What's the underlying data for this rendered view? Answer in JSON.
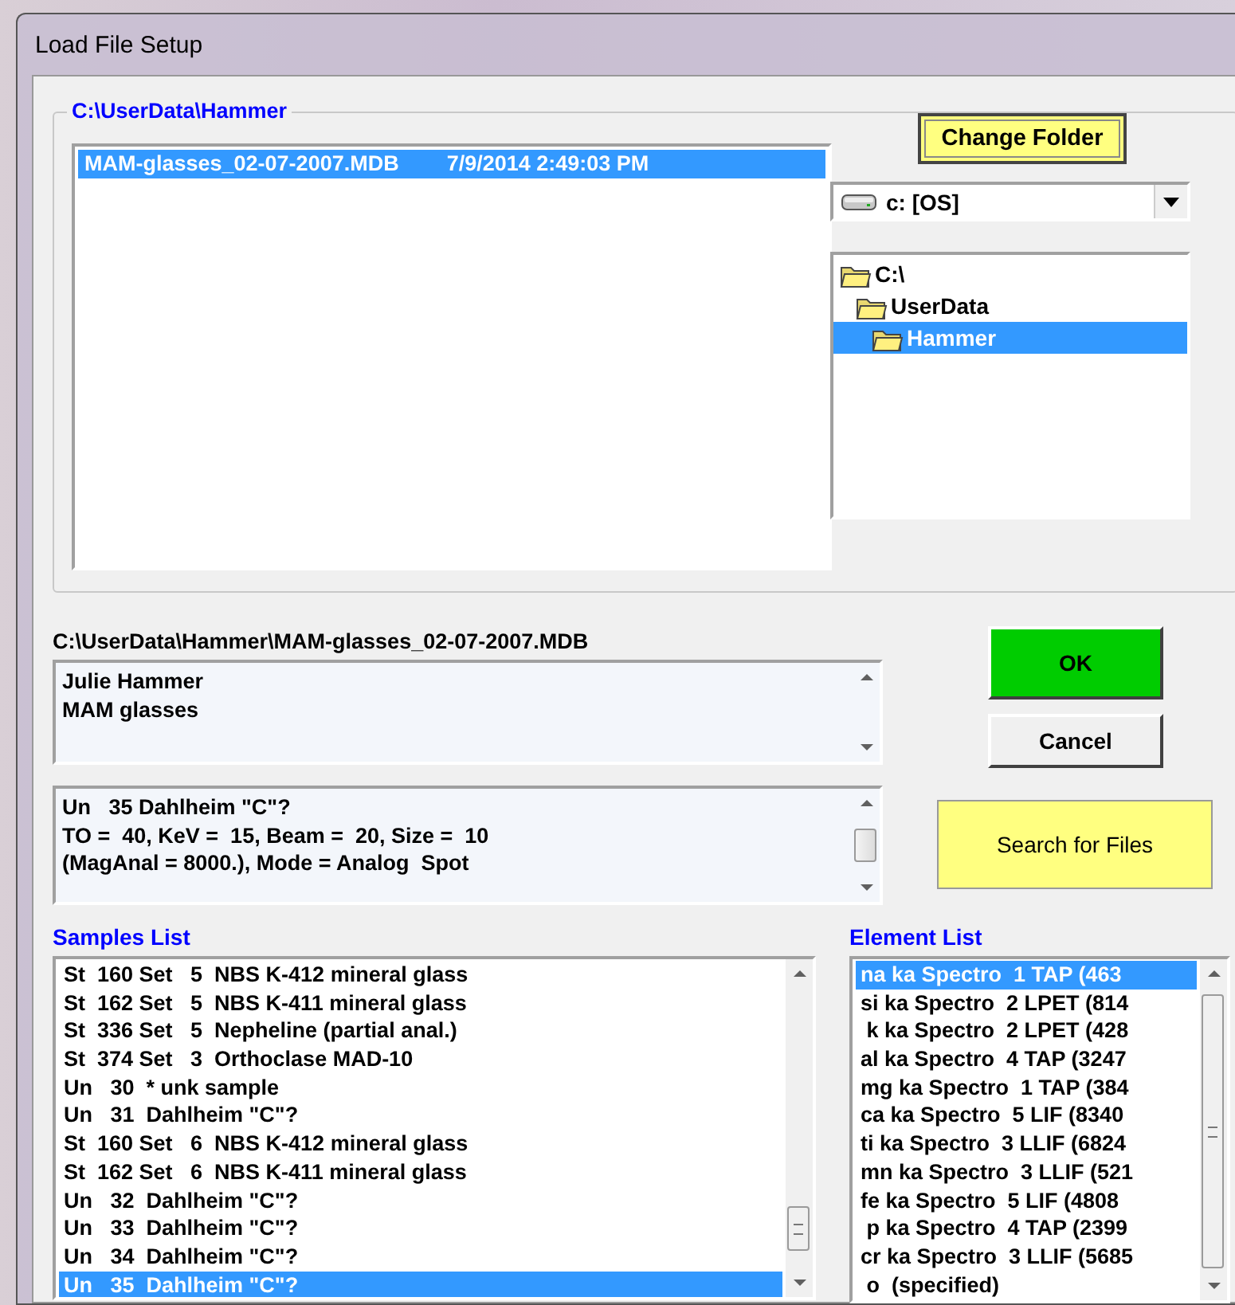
{
  "window": {
    "title": "Load File Setup"
  },
  "folder_group": {
    "title": "C:\\UserData\\Hammer",
    "files": [
      {
        "name": "MAM-glasses_02-07-2007.MDB",
        "date": "7/9/2014 2:49:03 PM",
        "selected": true
      }
    ]
  },
  "change_folder_button": {
    "label": "Change Folder"
  },
  "drive": {
    "value": "c: [OS]"
  },
  "folder_tree": [
    {
      "label": "C:\\",
      "selected": false,
      "children": [
        {
          "label": "UserData",
          "selected": false,
          "children": [
            {
              "label": "Hammer",
              "selected": true
            }
          ]
        }
      ]
    }
  ],
  "file_path": "C:\\UserData\\Hammer\\MAM-glasses_02-07-2007.MDB",
  "description": [
    "Julie Hammer",
    "MAM glasses"
  ],
  "sample_info": [
    "Un   35 Dahlheim \"C\"?",
    "TO =  40, KeV =  15, Beam =  20, Size =  10",
    "(MagAnal = 8000.), Mode = Analog  Spot"
  ],
  "buttons": [
    {
      "kind": "ok",
      "label": "OK"
    },
    {
      "kind": "cancel",
      "label": "Cancel"
    },
    {
      "kind": "search",
      "label": "Search for Files"
    }
  ],
  "samples_list": {
    "title": "Samples List",
    "items": [
      {
        "text": "St  160 Set   5  NBS K-412 mineral glass",
        "selected": false
      },
      {
        "text": "St  162 Set   5  NBS K-411 mineral glass",
        "selected": false
      },
      {
        "text": "St  336 Set   5  Nepheline (partial anal.)",
        "selected": false
      },
      {
        "text": "St  374 Set   3  Orthoclase MAD-10",
        "selected": false
      },
      {
        "text": "Un   30  * unk sample",
        "selected": false
      },
      {
        "text": "Un   31  Dahlheim \"C\"?",
        "selected": false
      },
      {
        "text": "St  160 Set   6  NBS K-412 mineral glass",
        "selected": false
      },
      {
        "text": "St  162 Set   6  NBS K-411 mineral glass",
        "selected": false
      },
      {
        "text": "Un   32  Dahlheim \"C\"?",
        "selected": false
      },
      {
        "text": "Un   33  Dahlheim \"C\"?",
        "selected": false
      },
      {
        "text": "Un   34  Dahlheim \"C\"?",
        "selected": false
      },
      {
        "text": "Un   35  Dahlheim \"C\"?",
        "selected": true
      }
    ]
  },
  "element_list": {
    "title": "Element List",
    "items": [
      {
        "text": "na ka Spectro  1 TAP (463",
        "selected": true
      },
      {
        "text": "si ka Spectro  2 LPET (814",
        "selected": false
      },
      {
        "text": " k ka Spectro  2 LPET (428",
        "selected": false
      },
      {
        "text": "al ka Spectro  4 TAP (3247",
        "selected": false
      },
      {
        "text": "mg ka Spectro  1 TAP (384",
        "selected": false
      },
      {
        "text": "ca ka Spectro  5 LIF (8340",
        "selected": false
      },
      {
        "text": "ti ka Spectro  3 LLIF (6824",
        "selected": false
      },
      {
        "text": "mn ka Spectro  3 LLIF (521",
        "selected": false
      },
      {
        "text": "fe ka Spectro  5 LIF (4808",
        "selected": false
      },
      {
        "text": " p ka Spectro  4 TAP (2399",
        "selected": false
      },
      {
        "text": "cr ka Spectro  3 LLIF (5685",
        "selected": false
      },
      {
        "text": " o  (specified)",
        "selected": false
      }
    ]
  }
}
